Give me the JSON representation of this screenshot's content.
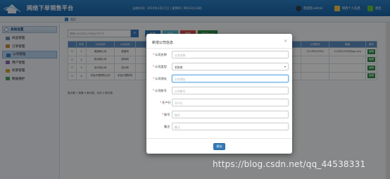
{
  "header": {
    "title": "网络下单销售平台",
    "login_info": "当前时间：2019年1月17日 | 星期四 | 9时33分33秒",
    "welcome": "欢迎您,admin",
    "modify_info": "修改个人信息",
    "logout": "退出"
  },
  "breadcrumb": {
    "home": "首页"
  },
  "sidebar": {
    "section": "系统设置",
    "items": [
      {
        "label": "商品管理",
        "active": false
      },
      {
        "label": "订单管理",
        "active": false
      },
      {
        "label": "公司管理",
        "active": true
      },
      {
        "label": "用户管理",
        "active": false
      },
      {
        "label": "权限管理",
        "active": false
      },
      {
        "label": "数据维护",
        "active": false
      }
    ]
  },
  "content": {
    "search_placeholder": "模糊公司名称/公司地址/开户行",
    "buttons": [
      "新增",
      "修改",
      "删除",
      "导出Excel"
    ],
    "table": {
      "headers": [
        "",
        "序号",
        "公司名称",
        "公司名称",
        "",
        "",
        "",
        "",
        "开户行",
        "公司账号",
        "邮箱",
        "操作"
      ],
      "rows": [
        [
          "",
          "1",
          "美团网公司",
          "美团网",
          "",
          "",
          "",
          "",
          "",
          "11176224794",
          "1176224794@qq.com",
          "编辑"
        ],
        [
          "",
          "2",
          "我司网公司",
          "我司网",
          "",
          "",
          "",
          "",
          "",
          "",
          "",
          "编辑"
        ],
        [
          "",
          "3",
          "设计师公司",
          "设计师",
          "",
          "",
          "",
          "",
          "",
          "",
          "",
          "编辑"
        ],
        [
          "",
          "4",
          "未会代理机构公司",
          "未会代理机构",
          "",
          "",
          "",
          "",
          "",
          "",
          "",
          "编辑"
        ]
      ]
    },
    "pager": "显示第 1 到第 4 条记录，总共 4 条记录"
  },
  "modal": {
    "title": "新增公司信息",
    "close": "×",
    "fields": [
      {
        "label": "公司名称",
        "required": true,
        "placeholder": "公司名称",
        "value": "",
        "type": "text"
      },
      {
        "label": "公司类型",
        "required": true,
        "placeholder": "",
        "value": "采购商",
        "type": "select"
      },
      {
        "label": "公司地址",
        "required": true,
        "placeholder": "公司地址",
        "value": "",
        "type": "text",
        "focus": true
      },
      {
        "label": "公司账号",
        "required": true,
        "placeholder": "公司账号",
        "value": "",
        "type": "text"
      },
      {
        "label": "开户行",
        "required": true,
        "placeholder": "开户行",
        "value": "",
        "type": "text"
      },
      {
        "label": "账号",
        "required": true,
        "placeholder": "账号",
        "value": "",
        "type": "text"
      },
      {
        "label": "备注",
        "required": false,
        "placeholder": "备注",
        "value": "",
        "type": "text"
      }
    ],
    "save_label": "保存"
  },
  "watermark": "https://blog.csdn.net/qq_44538331",
  "colors": {
    "header_blue": "#1c65a9",
    "primary_button": "#337ab7",
    "table_header": "#5d8ec3",
    "required_star": "#d9302c"
  }
}
